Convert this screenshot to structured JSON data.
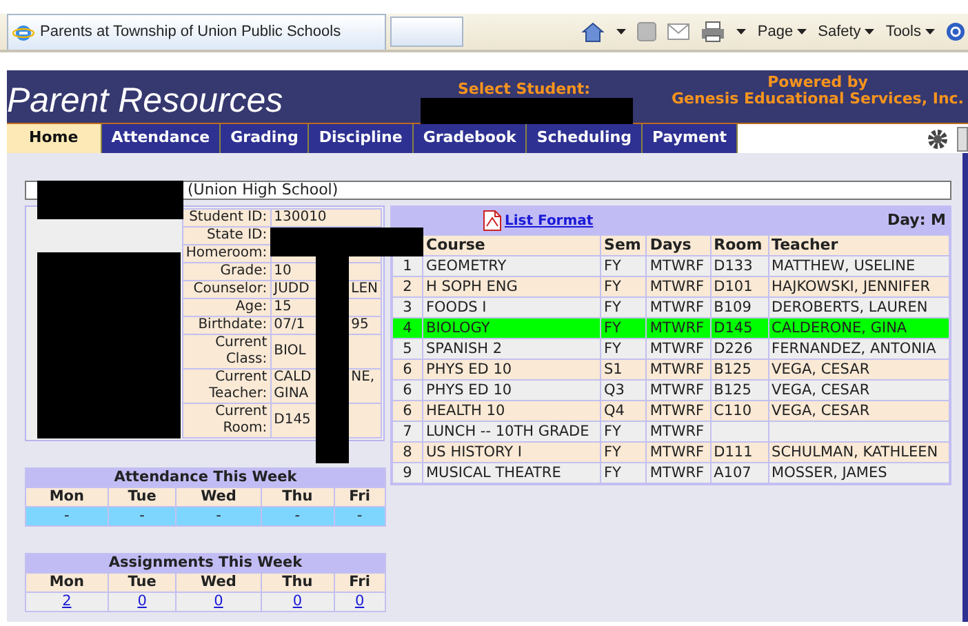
{
  "browser": {
    "tab_title": "Parents at Township of Union Public Schools",
    "menus": [
      "Page",
      "Safety",
      "Tools"
    ]
  },
  "header": {
    "title": "Parent Resources",
    "select_label": "Select Student:",
    "powered": [
      "Powered by",
      "Genesis Educational Services, Inc."
    ]
  },
  "nav": [
    {
      "label": "Home",
      "selected": true
    },
    {
      "label": "Attendance",
      "selected": false
    },
    {
      "label": "Grading",
      "selected": false
    },
    {
      "label": "Discipline",
      "selected": false
    },
    {
      "label": "Gradebook",
      "selected": false
    },
    {
      "label": "Scheduling",
      "selected": false
    },
    {
      "label": "Payment",
      "selected": false
    }
  ],
  "student": {
    "school": "(Union High School)",
    "info": [
      {
        "label": "Student ID:",
        "value": [
          [
            "130010"
          ]
        ]
      },
      {
        "label": "State ID:"
      },
      {
        "label": "Homeroom:"
      },
      {
        "label": "Grade:",
        "value": [
          [
            "10"
          ]
        ]
      },
      {
        "label": "Counselor:",
        "value": [
          [
            "JUDD",
            "LEN"
          ]
        ]
      },
      {
        "label": "Age:",
        "value": [
          [
            "15"
          ]
        ]
      },
      {
        "label": "Birthdate:",
        "value": [
          [
            "07/1",
            "95"
          ]
        ]
      },
      {
        "label": "Current Class:",
        "value": [
          [
            "BIOL"
          ]
        ]
      },
      {
        "label": "Current Teacher:",
        "value": [
          [
            "CALD",
            "NE,"
          ],
          [
            "GINA"
          ]
        ]
      },
      {
        "label": "Current Room:",
        "value": [
          [
            "D145"
          ]
        ]
      }
    ]
  },
  "schedule": {
    "link": "List Format",
    "day": "Day: M",
    "columns": [
      "Course",
      "Sem",
      "Days",
      "Room",
      "Teacher"
    ],
    "rows": [
      {
        "period": "1",
        "course": "GEOMETRY",
        "sem": "FY",
        "days": "MTWRF",
        "room": "D133",
        "teacher": "MATTHEW, USELINE",
        "selected": false
      },
      {
        "period": "2",
        "course": "H SOPH ENG",
        "sem": "FY",
        "days": "MTWRF",
        "room": "D101",
        "teacher": "HAJKOWSKI, JENNIFER",
        "selected": false
      },
      {
        "period": "3",
        "course": "FOODS I",
        "sem": "FY",
        "days": "MTWRF",
        "room": "B109",
        "teacher": "DEROBERTS, LAUREN",
        "selected": false
      },
      {
        "period": "4",
        "course": "BIOLOGY",
        "sem": "FY",
        "days": "MTWRF",
        "room": "D145",
        "teacher": "CALDERONE, GINA",
        "selected": true
      },
      {
        "period": "5",
        "course": "SPANISH 2",
        "sem": "FY",
        "days": "MTWRF",
        "room": "D226",
        "teacher": "FERNANDEZ, ANTONIA",
        "selected": false
      },
      {
        "period": "6",
        "course": "PHYS ED 10",
        "sem": "S1",
        "days": "MTWRF",
        "room": "B125",
        "teacher": "VEGA, CESAR",
        "selected": false
      },
      {
        "period": "6",
        "course": "PHYS ED 10",
        "sem": "Q3",
        "days": "MTWRF",
        "room": "B125",
        "teacher": "VEGA, CESAR",
        "selected": false
      },
      {
        "period": "6",
        "course": "HEALTH 10",
        "sem": "Q4",
        "days": "MTWRF",
        "room": "C110",
        "teacher": "VEGA, CESAR",
        "selected": false
      },
      {
        "period": "7",
        "course": "LUNCH -- 10TH GRADE",
        "sem": "FY",
        "days": "MTWRF",
        "selected": false
      },
      {
        "period": "8",
        "course": "US HISTORY I",
        "sem": "FY",
        "days": "MTWRF",
        "room": "D111",
        "teacher": "SCHULMAN, KATHLEEN",
        "selected": false
      },
      {
        "period": "9",
        "course": "MUSICAL THEATRE",
        "sem": "FY",
        "days": "MTWRF",
        "room": "A107",
        "teacher": "MOSSER, JAMES",
        "selected": false
      }
    ]
  },
  "attendance": {
    "title": "Attendance This Week",
    "days": [
      "Mon",
      "Tue",
      "Wed",
      "Thu",
      "Fri"
    ],
    "values": [
      "-",
      "-",
      "-",
      "-",
      "-"
    ]
  },
  "assignments": {
    "title": "Assignments This Week",
    "days": [
      "Mon",
      "Tue",
      "Wed",
      "Thu",
      "Fri"
    ],
    "values": [
      "2",
      "0",
      "0",
      "0",
      "0"
    ]
  }
}
